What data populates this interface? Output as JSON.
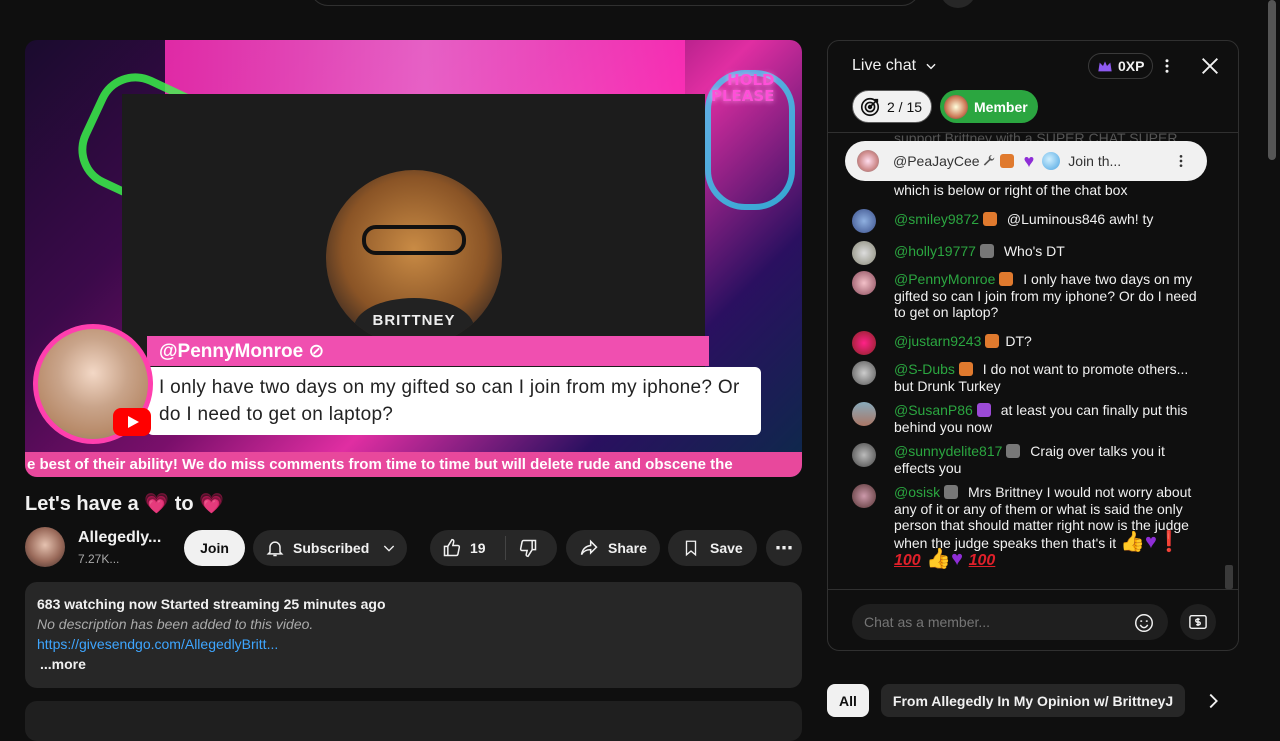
{
  "video": {
    "hold_line1": "HOLD",
    "hold_line2": "PLEASE",
    "shirt_text": "BRITTNEY",
    "overlay_name": "@PennyMonroe ⊘",
    "overlay_message": "I only have two days on my gifted so can I join from my iphone? Or do I need to get on laptop?",
    "ticker": "e best of their ability! We do miss comments from time to time but will delete rude and obscene the"
  },
  "title": {
    "pre": "Let's have a ",
    "mid": " to ",
    "heart": "💗"
  },
  "channel": {
    "name": "Allegedly...",
    "subs": "7.27K..."
  },
  "actions": {
    "join": "Join",
    "subscribed": "Subscribed",
    "likes": "19",
    "share": "Share",
    "save": "Save",
    "more": "⋯"
  },
  "description": {
    "stats": "683 watching now  Started streaming 25 minutes ago",
    "no_desc": "No description has been added to this video.",
    "link": "https://givesendgo.com/AllegedlyBritt...",
    "more": "...more"
  },
  "chat": {
    "title": "Live chat",
    "xp": "0XP",
    "goal": "2 / 15",
    "member": "Member",
    "faded_text": "support Brittney with a SUPER CHAT SUPER",
    "pinned": {
      "author": "@PeaJayCee",
      "join": "Join th..."
    },
    "input_placeholder": "Chat as a member...",
    "messages": [
      {
        "author": "",
        "text": "which is below or right of the chat box"
      },
      {
        "author": "@smiley9872",
        "text": "@Luminous846 awh! ty"
      },
      {
        "author": "@holly19777",
        "text": "Who's DT"
      },
      {
        "author": "@PennyMonroe",
        "text": "I only have two days on my gifted so can I join from my iphone? Or do I need to get on laptop?"
      },
      {
        "author": "@justarn9243",
        "text": "DT?"
      },
      {
        "author": "@S-Dubs",
        "text": "I do not want to promote others... but Drunk Turkey"
      },
      {
        "author": "@SusanP86",
        "text": "at least you can finally put this behind you now"
      },
      {
        "author": "@sunnydelite817",
        "text": "Craig over talks you it effects you"
      },
      {
        "author": "@osisk",
        "text": "Mrs Brittney I would not worry about any of it or any of them or what is said the only person that should matter right now is the judge when the judge speaks then that's it"
      }
    ]
  },
  "chips": [
    "All",
    "From Allegedly In My Opinion w/ BrittneyJ"
  ],
  "colors": {
    "accent_green": "#2ba640",
    "link_blue": "#3ea6ff",
    "brand_pink": "#e8489c"
  }
}
